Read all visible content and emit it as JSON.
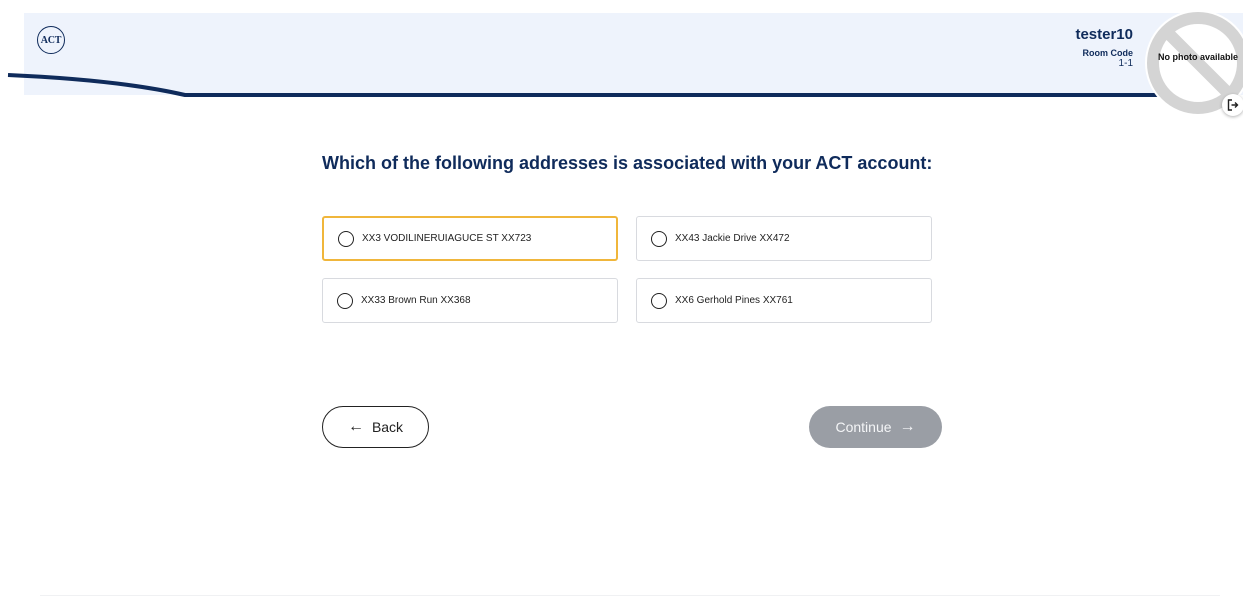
{
  "header": {
    "logo_text": "ACT",
    "username": "tester10",
    "room_label": "Room Code",
    "room_code": "1-1",
    "photo_text": "No photo available",
    "accent_color": "#0f2b5b",
    "icons": {
      "logout": "logout-icon",
      "photo": "no-photo-icon"
    }
  },
  "question": "Which of the following addresses is associated with your ACT account:",
  "options": [
    {
      "label": "XX3 VODILINERUIAGUCE ST XX723",
      "selected": true
    },
    {
      "label": "XX43 Jackie Drive XX472",
      "selected": false
    },
    {
      "label": "XX33 Brown Run XX368",
      "selected": false
    },
    {
      "label": "XX6 Gerhold Pines XX761",
      "selected": false
    }
  ],
  "selected_border_color": "#f0b63b",
  "nav": {
    "back_label": "Back",
    "back_arrow": "←",
    "continue_label": "Continue",
    "continue_arrow": "→",
    "continue_color": "#9a9ea5"
  }
}
